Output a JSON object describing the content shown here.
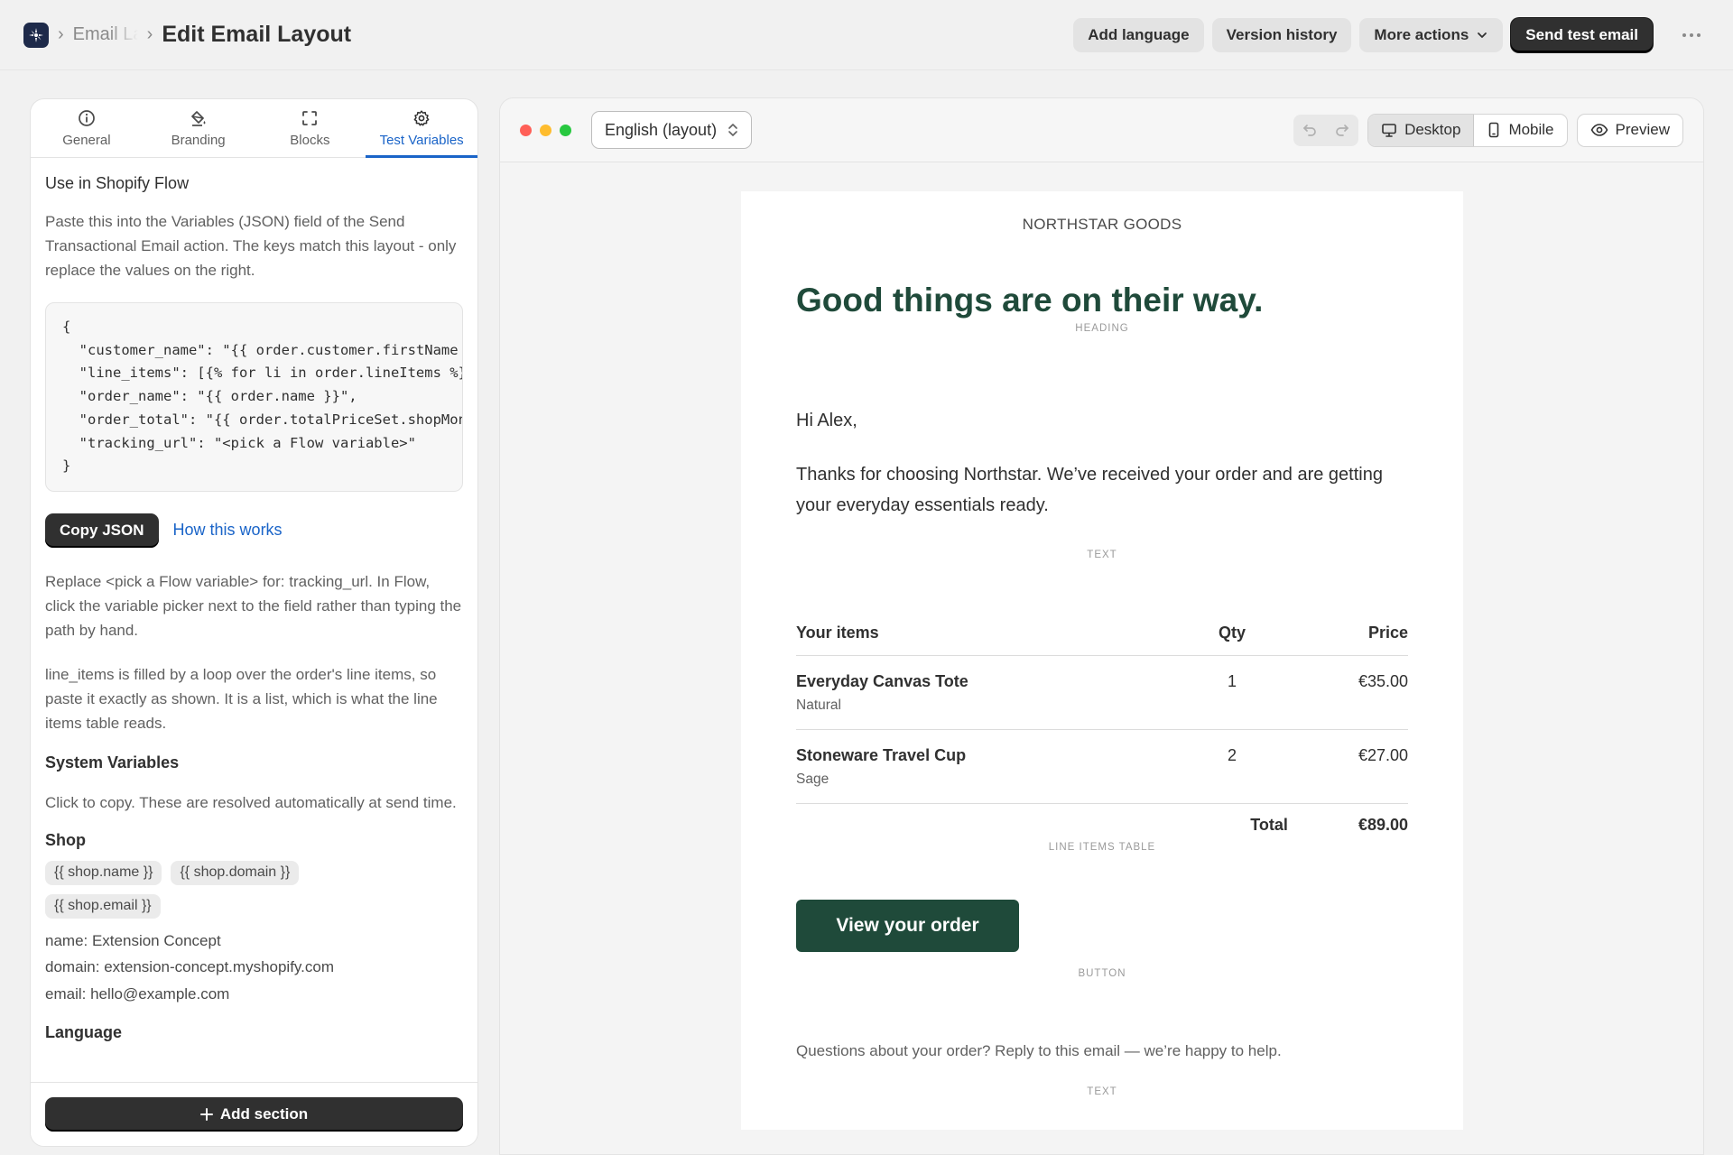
{
  "header": {
    "breadcrumb_parent": "Email Layouts",
    "title": "Edit Email Layout",
    "actions": {
      "add_language": "Add language",
      "version_history": "Version history",
      "more_actions": "More actions",
      "send_test": "Send test email"
    }
  },
  "left_panel": {
    "tabs": [
      {
        "label": "General",
        "icon": "info-icon"
      },
      {
        "label": "Branding",
        "icon": "paint-bucket-icon"
      },
      {
        "label": "Blocks",
        "icon": "blocks-icon"
      },
      {
        "label": "Test Variables",
        "icon": "gear-icon"
      }
    ],
    "active_tab": "Test Variables",
    "section_title": "Use in Shopify Flow",
    "intro": "Paste this into the Variables (JSON) field of the Send Transactional Email action. The keys match this layout - only replace the values on the right.",
    "code_lines": [
      "{",
      "  \"customer_name\": \"{{ order.customer.firstName }}\",",
      "  \"line_items\": [{% for li in order.lineItems %}",
      "  \"order_name\": \"{{ order.name }}\",",
      "  \"order_total\": \"{{ order.totalPriceSet.shopMoney.amount }}\",",
      "  \"tracking_url\": \"<pick a Flow variable>\"",
      "}"
    ],
    "copy_json": "Copy JSON",
    "how_link": "How this works",
    "note_tracking": "Replace <pick a Flow variable> for: tracking_url. In Flow, click the variable picker next to the field rather than typing the path by hand.",
    "note_line_items": "line_items is filled by a loop over the order's line items, so paste it exactly as shown. It is a list, which is what the line items table reads.",
    "system_title": "System Variables",
    "system_intro": "Click to copy. These are resolved automatically at send time.",
    "shop_title": "Shop",
    "shop_chips": [
      "{{ shop.name }}",
      "{{ shop.domain }}",
      "{{ shop.email }}"
    ],
    "shop_values": [
      "name: Extension Concept",
      "domain: extension-concept.myshopify.com",
      "email: hello@example.com"
    ],
    "language_title": "Language",
    "add_section": "Add section"
  },
  "preview": {
    "language_select": "English (layout)",
    "devices": {
      "desktop": "Desktop",
      "mobile": "Mobile"
    },
    "active_device": "Desktop",
    "preview_label": "Preview",
    "traffic_colors": [
      "#ff5f57",
      "#febc2e",
      "#28c840"
    ]
  },
  "email": {
    "brand": "NORTHSTAR GOODS",
    "headline": "Good things are on their way.",
    "greeting": "Hi Alex,",
    "body": "Thanks for choosing Northstar. We’ve received your order and are getting your everyday essentials ready.",
    "table": {
      "headers": {
        "name": "Your items",
        "qty": "Qty",
        "price": "Price"
      },
      "rows": [
        {
          "name": "Everyday Canvas Tote",
          "variant": "Natural",
          "qty": "1",
          "price": "€35.00"
        },
        {
          "name": "Stoneware Travel Cup",
          "variant": "Sage",
          "qty": "2",
          "price": "€27.00"
        }
      ],
      "total_label": "Total",
      "total_value": "€89.00"
    },
    "button": "View your order",
    "footer": "Questions about your order? Reply to this email — we’re happy to help.",
    "block_labels": {
      "heading": "HEADING",
      "text": "TEXT",
      "table": "LINE ITEMS TABLE",
      "button": "BUTTON"
    },
    "accent_color": "#1f4a3a"
  }
}
